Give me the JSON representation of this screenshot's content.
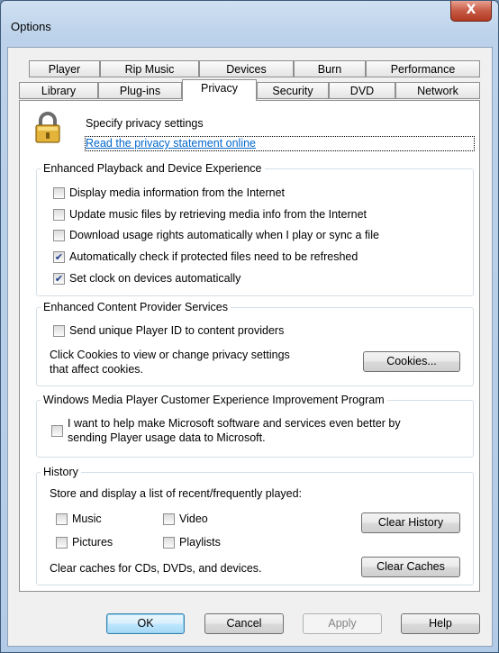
{
  "window": {
    "title": "Options",
    "close_glyph": "X"
  },
  "tabs": {
    "row1": [
      "Player",
      "Rip Music",
      "Devices",
      "Burn",
      "Performance"
    ],
    "row2": [
      "Library",
      "Plug-ins",
      "Privacy",
      "Security",
      "DVD",
      "Network"
    ]
  },
  "header": {
    "icon": "lock-icon",
    "text": "Specify privacy settings",
    "link": "Read the privacy statement online"
  },
  "enhanced_playback": {
    "legend": "Enhanced Playback and Device Experience",
    "items": [
      {
        "label": "Display media information from the Internet",
        "checked": false
      },
      {
        "label": "Update music files by retrieving media info from the Internet",
        "checked": false
      },
      {
        "label": "Download usage rights automatically when I play or sync a file",
        "checked": false
      },
      {
        "label": "Automatically check if protected files need to be refreshed",
        "checked": true
      },
      {
        "label": "Set clock on devices automatically",
        "checked": true
      }
    ]
  },
  "content_provider": {
    "legend": "Enhanced Content Provider Services",
    "item": {
      "label": "Send unique Player ID to content providers",
      "checked": false
    },
    "cookies_text_line1": "Click Cookies to view or change privacy settings",
    "cookies_text_line2": "that affect cookies.",
    "cookies_button": "Cookies..."
  },
  "ceip": {
    "legend": "Windows Media Player Customer Experience Improvement Program",
    "line1": "I want to help make Microsoft software and services even better by",
    "line2": "sending Player usage data to Microsoft.",
    "checked": false
  },
  "history": {
    "legend": "History",
    "description": "Store and display a list of recent/frequently played:",
    "music": "Music",
    "video": "Video",
    "pictures": "Pictures",
    "playlists": "Playlists",
    "clear_history": "Clear History",
    "caches_text": "Clear caches for CDs, DVDs, and devices.",
    "clear_caches": "Clear Caches"
  },
  "buttons": {
    "ok": "OK",
    "cancel": "Cancel",
    "apply": "Apply",
    "help": "Help"
  },
  "colors": {
    "link": "#0066cc",
    "close": "#c75a45",
    "accent": "#3c7fb1"
  }
}
